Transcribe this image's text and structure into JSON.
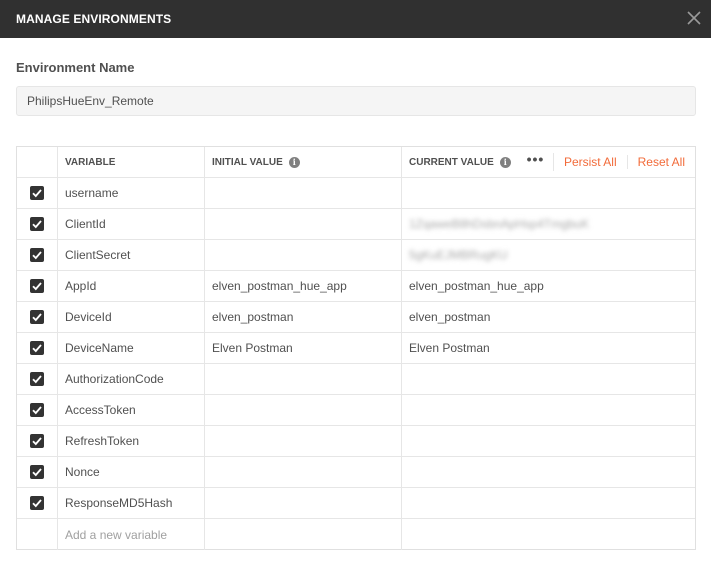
{
  "dialog": {
    "title": "MANAGE ENVIRONMENTS",
    "close_icon": "close-icon"
  },
  "environment": {
    "label": "Environment Name",
    "value": "PhilipsHueEnv_Remote"
  },
  "table": {
    "headers": {
      "variable": "VARIABLE",
      "initial_value": "INITIAL VALUE",
      "current_value": "CURRENT VALUE",
      "info_icon": "i",
      "more_icon": "•••",
      "persist_all": "Persist All",
      "reset_all": "Reset All"
    },
    "rows": [
      {
        "checked": true,
        "variable": "username",
        "initial": "",
        "current": ""
      },
      {
        "checked": true,
        "variable": "ClientId",
        "initial": "",
        "current": "1ZqaweB8hDsbnApHsp4TmgbuK",
        "current_obscured": true
      },
      {
        "checked": true,
        "variable": "ClientSecret",
        "initial": "",
        "current": "5gKuEJMBRugKU",
        "current_obscured": true
      },
      {
        "checked": true,
        "variable": "AppId",
        "initial": "elven_postman_hue_app",
        "current": "elven_postman_hue_app"
      },
      {
        "checked": true,
        "variable": "DeviceId",
        "initial": "elven_postman",
        "current": "elven_postman"
      },
      {
        "checked": true,
        "variable": "DeviceName",
        "initial": "Elven Postman",
        "current": "Elven Postman"
      },
      {
        "checked": true,
        "variable": "AuthorizationCode",
        "initial": "",
        "current": ""
      },
      {
        "checked": true,
        "variable": "AccessToken",
        "initial": "",
        "current": ""
      },
      {
        "checked": true,
        "variable": "RefreshToken",
        "initial": "",
        "current": ""
      },
      {
        "checked": true,
        "variable": "Nonce",
        "initial": "",
        "current": ""
      },
      {
        "checked": true,
        "variable": "ResponseMD5Hash",
        "initial": "",
        "current": ""
      }
    ],
    "new_variable_placeholder": "Add a new variable"
  },
  "colors": {
    "titlebar": "#303030",
    "accent": "#f26b3a",
    "checkbox": "#333333"
  }
}
